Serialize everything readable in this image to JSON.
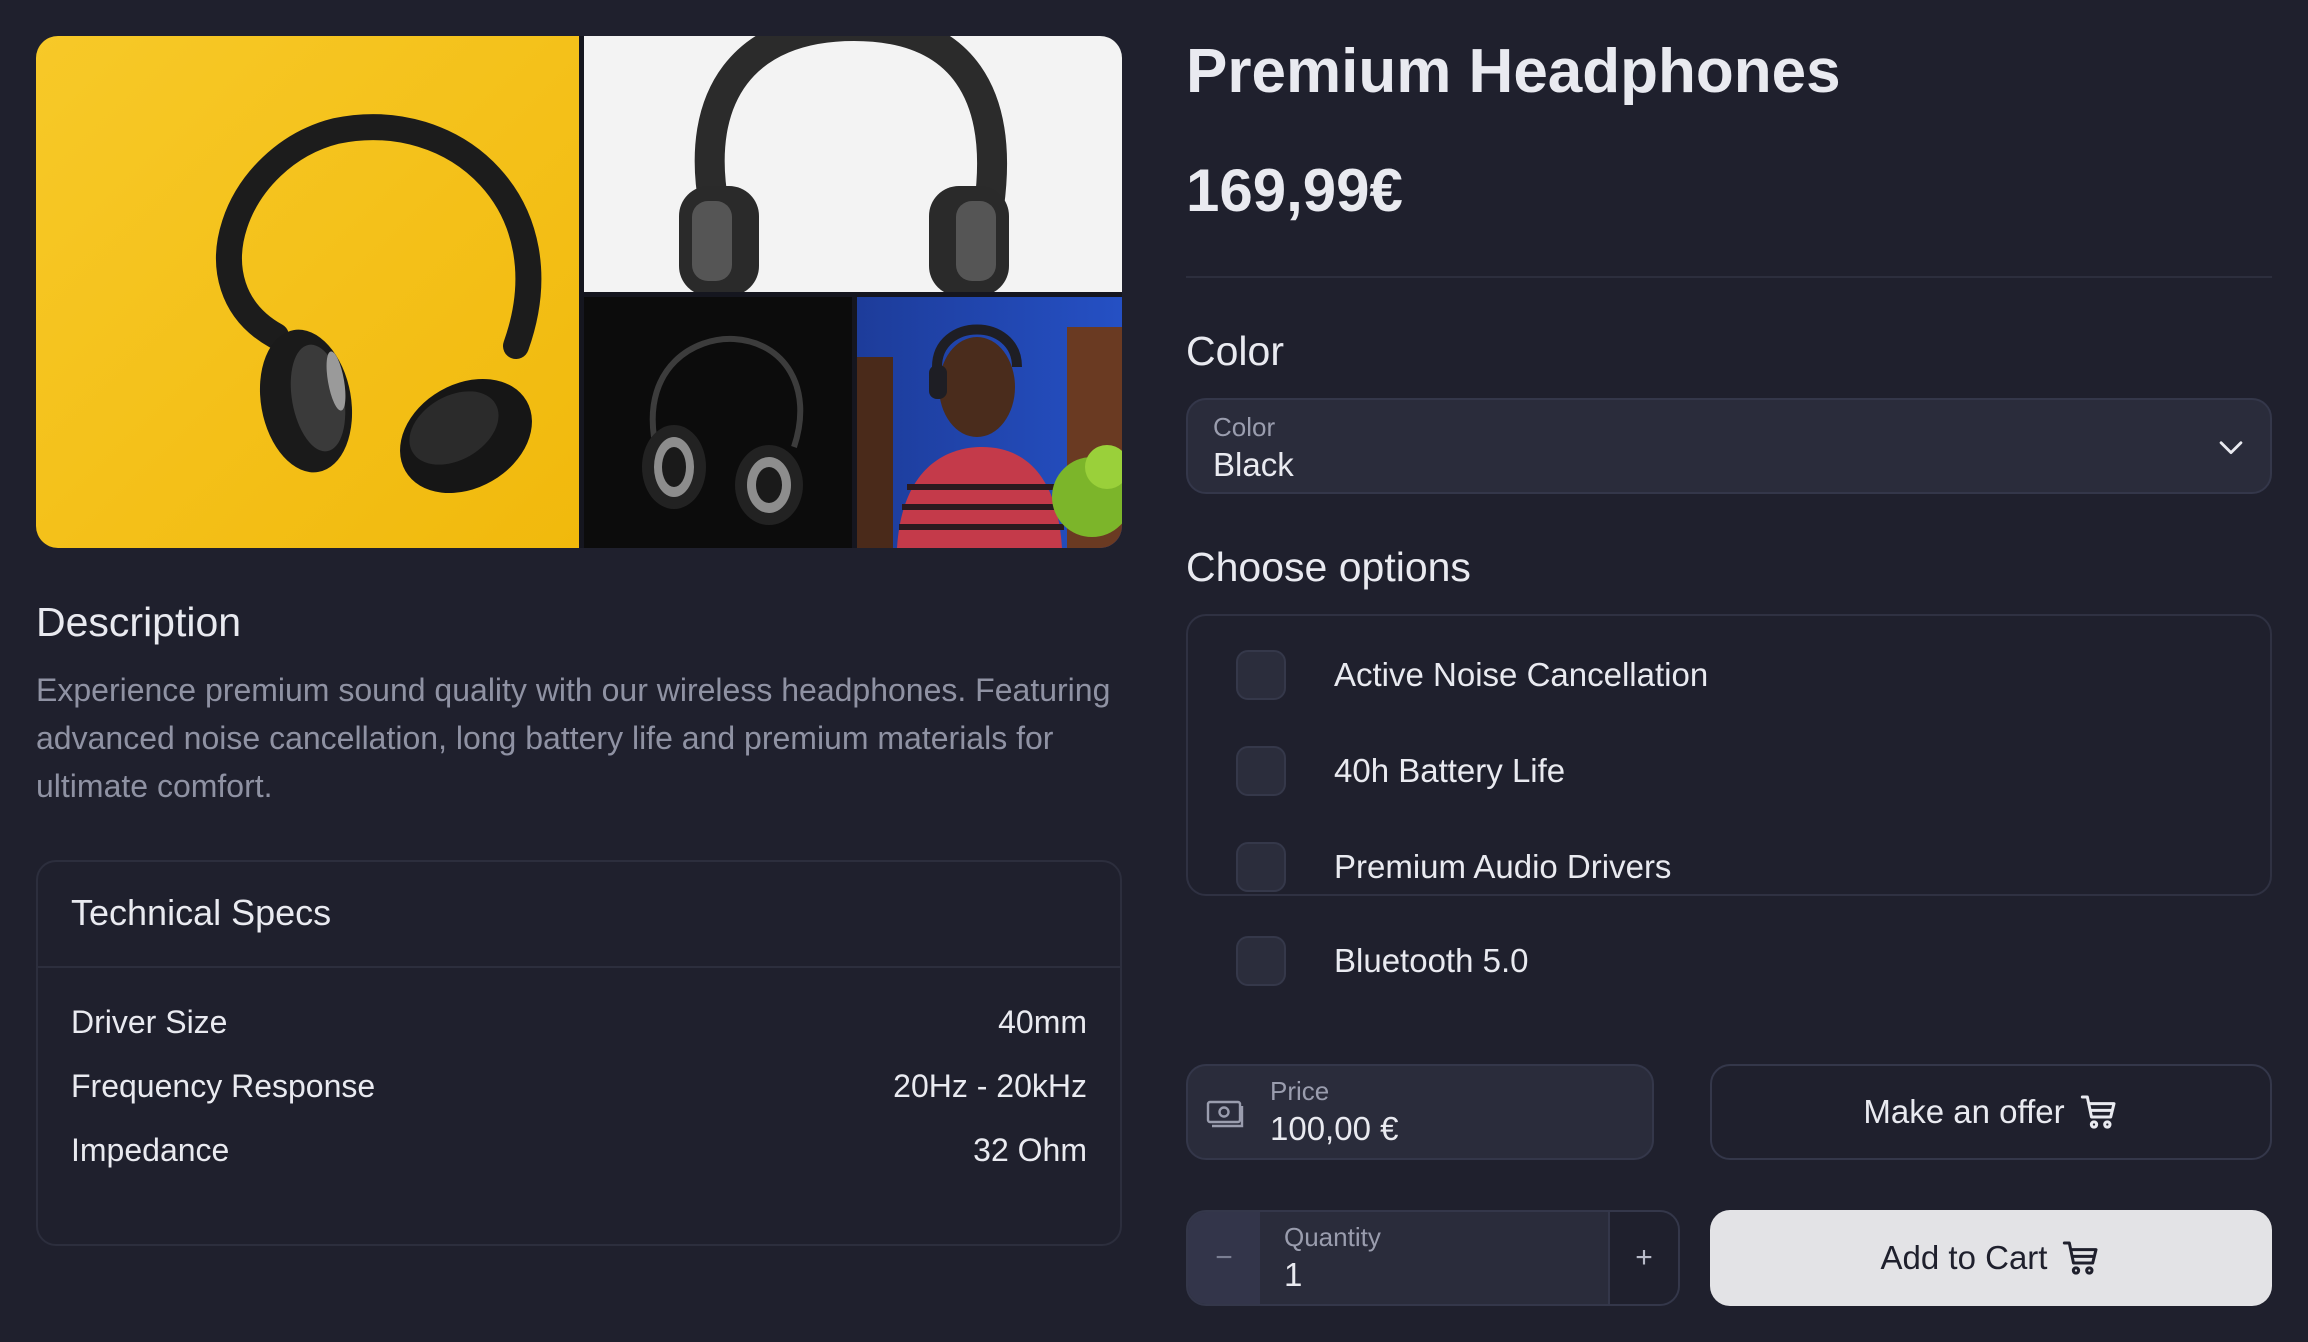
{
  "product": {
    "title": "Premium Headphones",
    "price": "169,99€"
  },
  "gallery": {
    "images": [
      {
        "name": "headphones-on-yellow"
      },
      {
        "name": "headphones-on-white"
      },
      {
        "name": "headphones-on-black"
      },
      {
        "name": "person-wearing-headphones"
      }
    ]
  },
  "description": {
    "heading": "Description",
    "text": "Experience premium sound quality with our wireless headphones. Featuring advanced noise cancellation, long battery life and premium materials for ultimate comfort."
  },
  "specs": {
    "heading": "Technical Specs",
    "rows": [
      {
        "label": "Driver Size",
        "value": "40mm"
      },
      {
        "label": "Frequency Response",
        "value": "20Hz - 20kHz"
      },
      {
        "label": "Impedance",
        "value": "32 Ohm"
      }
    ]
  },
  "color": {
    "heading": "Color",
    "label": "Color",
    "value": "Black"
  },
  "options": {
    "heading": "Choose options",
    "items": [
      {
        "label": "Active Noise Cancellation",
        "checked": false
      },
      {
        "label": "40h Battery Life",
        "checked": false
      },
      {
        "label": "Premium Audio Drivers",
        "checked": false
      },
      {
        "label": "Bluetooth 5.0",
        "checked": false
      }
    ]
  },
  "offer": {
    "price_label": "Price",
    "price_value": "100,00 €",
    "button_label": "Make an offer"
  },
  "quantity": {
    "label": "Quantity",
    "value": "1",
    "minus": "−",
    "plus": "+"
  },
  "cart": {
    "button_label": "Add to Cart"
  },
  "colors": {
    "background": "#1f202d",
    "panel": "#2a2c3b",
    "border": "#34374a",
    "text": "#e9eaf0",
    "muted": "#8f92a3",
    "cart_button": "#e3e3e6",
    "yellow_photo": "#f5c518"
  }
}
